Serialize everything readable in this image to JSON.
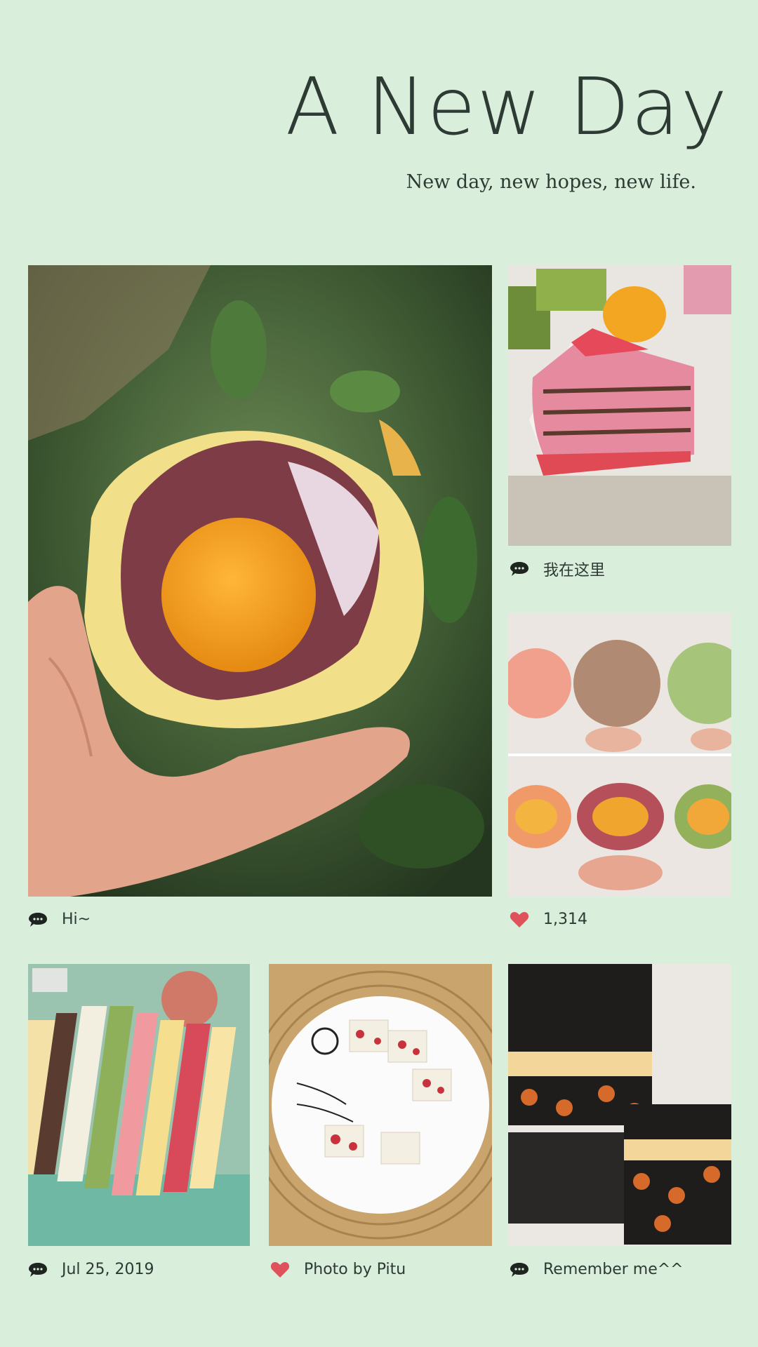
{
  "header": {
    "title": "A New Day",
    "subtitle": "New day, new hopes, new life."
  },
  "photos": [
    {
      "name": "mooncake-photo",
      "description": "hand holding mooncake with salted egg yolk"
    },
    {
      "name": "crepe-cake-photo"
    },
    {
      "name": "pastry-grid-photo"
    },
    {
      "name": "sandwich-cake-photo"
    },
    {
      "name": "nougat-plate-photo"
    },
    {
      "name": "gift-box-photo"
    }
  ],
  "captions": [
    {
      "icon": "comment-icon",
      "text": "我在这里"
    },
    {
      "icon": "comment-icon",
      "text": "Hi~"
    },
    {
      "icon": "heart-icon",
      "text": "1,314"
    },
    {
      "icon": "comment-icon",
      "text": "Jul 25, 2019"
    },
    {
      "icon": "heart-icon",
      "text": "Photo by Pitu"
    },
    {
      "icon": "comment-icon",
      "text": "Remember me^^"
    }
  ],
  "colors": {
    "background": "#d9eedb",
    "text": "#2e3a34",
    "heart": "#e0525b"
  }
}
